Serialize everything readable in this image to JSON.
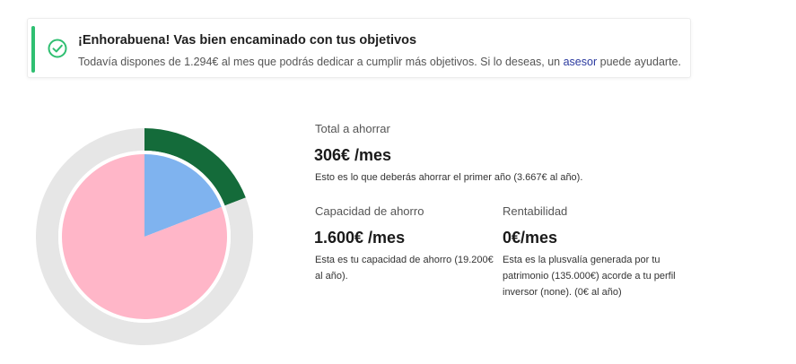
{
  "alert": {
    "title": "¡Enhorabuena! Vas bien encaminado con tus objetivos",
    "text_before": "Todavía dispones de 1.294€ al mes que podrás dedicar a cumplir más objetivos. Si lo deseas, un",
    "link": "asesor",
    "text_after": "puede ayudarte.",
    "icon": "check-circle-icon",
    "accent_color": "#2fbf71"
  },
  "total": {
    "label": "Total a ahorrar",
    "value": "306€ /mes",
    "desc": "Esto es lo que deberás ahorrar el primer año (3.667€ al año)."
  },
  "capacity": {
    "label": "Capacidad de ahorro",
    "value": "1.600€ /mes",
    "desc": "Esta es tu capacidad de ahorro (19.200€ al año)."
  },
  "returns": {
    "label": "Rentabilidad",
    "value": "0€/mes",
    "desc": "Esta es la plusvalía generada por tu patrimonio (135.000€) acorde a tu perfil inversor (none). (0€ al año)"
  },
  "chart_data": {
    "type": "pie",
    "inner": {
      "slices": [
        {
          "value": 306,
          "color": "#7fb3ef"
        },
        {
          "value": 1294,
          "color": "#ffb6c8"
        }
      ]
    },
    "outer": {
      "slices": [
        {
          "value": 306,
          "color": "#146b3a"
        },
        {
          "value": 1294,
          "color": "#e6e6e6"
        }
      ]
    }
  }
}
